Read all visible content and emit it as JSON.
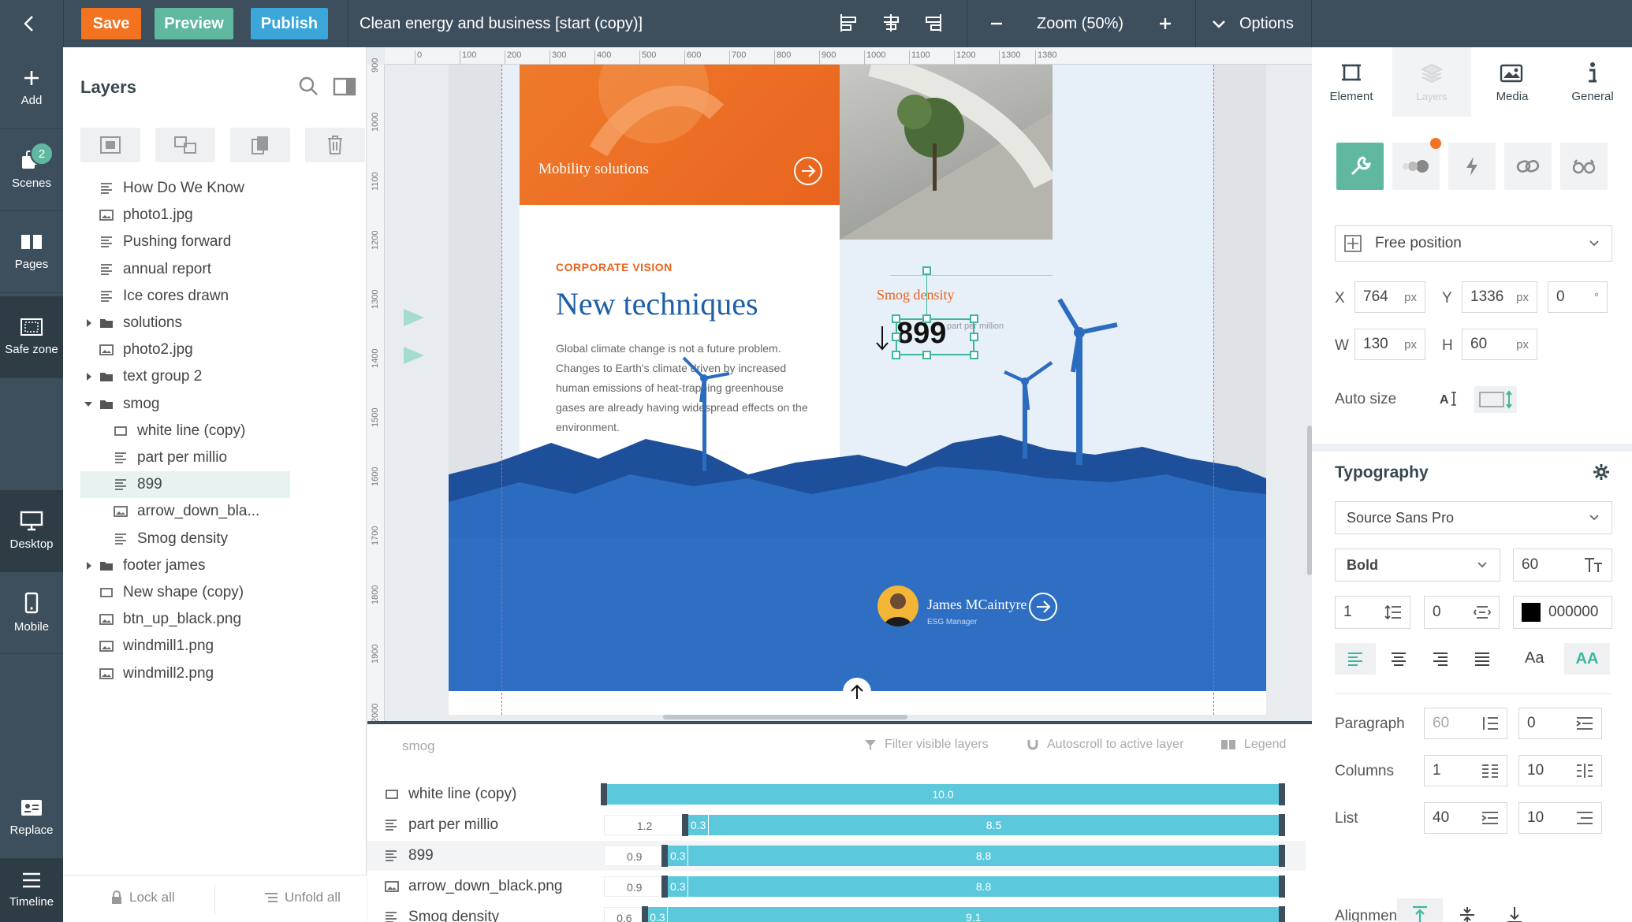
{
  "topbar": {
    "save": "Save",
    "preview": "Preview",
    "publish": "Publish",
    "title": "Clean energy and business [start (copy)]",
    "zoom": "Zoom (50%)",
    "options": "Options"
  },
  "rail": {
    "add": "Add",
    "scenes": "Scenes",
    "scenes_badge": "2",
    "pages": "Pages",
    "safe_zone": "Safe zone",
    "desktop": "Desktop",
    "mobile": "Mobile",
    "replace": "Replace",
    "timeline": "Timeline"
  },
  "layers": {
    "title": "Layers",
    "items": [
      {
        "label": "How Do We Know",
        "type": "text"
      },
      {
        "label": "photo1.jpg",
        "type": "image"
      },
      {
        "label": "Pushing forward",
        "type": "text"
      },
      {
        "label": "annual report",
        "type": "text"
      },
      {
        "label": "Ice cores drawn",
        "type": "text"
      },
      {
        "label": "solutions",
        "type": "folder"
      },
      {
        "label": "photo2.jpg",
        "type": "image"
      },
      {
        "label": "text group 2",
        "type": "folder"
      },
      {
        "label": "smog",
        "type": "folder-open"
      },
      {
        "label": "white line (copy)",
        "type": "shape"
      },
      {
        "label": "part per millio",
        "type": "text"
      },
      {
        "label": "899",
        "type": "text"
      },
      {
        "label": "arrow_down_bla...",
        "type": "image"
      },
      {
        "label": "Smog density",
        "type": "text"
      },
      {
        "label": "footer james",
        "type": "folder"
      },
      {
        "label": "New shape (copy)",
        "type": "shape"
      },
      {
        "label": "btn_up_black.png",
        "type": "image"
      },
      {
        "label": "windmill1.png",
        "type": "image"
      },
      {
        "label": "windmill2.png",
        "type": "image"
      }
    ],
    "lock_all": "Lock all",
    "unfold_all": "Unfold all"
  },
  "ruler": {
    "top": [
      "0",
      "100",
      "200",
      "300",
      "400",
      "500",
      "600",
      "700",
      "800",
      "900",
      "1000",
      "1100",
      "1200",
      "1300",
      "1380"
    ],
    "left": [
      "900",
      "1000",
      "1100",
      "1200",
      "1300",
      "1400",
      "1500",
      "1600",
      "1700",
      "1800",
      "1900",
      "2000"
    ]
  },
  "page": {
    "mobility": "Mobility solutions",
    "corporate_vision": "CORPORATE VISION",
    "headline": "New techniques",
    "body": "Global climate change is not a future problem. Changes to Earth's climate driven by increased human emissions of heat-trapping greenhouse gases are already having widespread effects on the environment.",
    "smog_density": "Smog density",
    "value": "899",
    "unit": "part per million",
    "person_name": "James MCaintyre",
    "person_role": "ESG Manager"
  },
  "rpanel": {
    "tabs": [
      "Element",
      "Layers",
      "Media",
      "General"
    ],
    "position_mode": "Free position",
    "x_label": "X",
    "x": "764",
    "y_label": "Y",
    "y": "1336",
    "rotation": "0",
    "w_label": "W",
    "w": "130",
    "h_label": "H",
    "h": "60",
    "unit": "px",
    "degree": "°",
    "auto_size": "Auto size",
    "typography": "Typography",
    "font": "Source Sans Pro",
    "weight": "Bold",
    "font_size": "60",
    "line_height": "1",
    "letter_spacing": "0",
    "color": "000000",
    "paragraph_label": "Paragraph",
    "paragraph_a": "60",
    "paragraph_b": "0",
    "columns_label": "Columns",
    "columns_a": "1",
    "columns_b": "10",
    "list_label": "List",
    "list_a": "40",
    "list_b": "10",
    "alignment_label": "Alignment",
    "case_label": "Aa",
    "caps_label": "AA"
  },
  "timeline": {
    "group": "smog",
    "filter": "Filter visible layers",
    "autoscroll": "Autoscroll to active layer",
    "legend": "Legend",
    "rows": [
      {
        "label": "white line (copy)",
        "type": "shape",
        "start": "",
        "delay": "",
        "duration": "10.0",
        "start_frac": 0.0,
        "delay_frac": 0.0
      },
      {
        "label": "part per millio",
        "type": "text",
        "start": "1.2",
        "delay": "0.3",
        "duration": "8.5",
        "start_frac": 0.12,
        "delay_frac": 0.03
      },
      {
        "label": "899",
        "type": "text",
        "start": "0.9",
        "delay": "0.3",
        "duration": "8.8",
        "start_frac": 0.09,
        "delay_frac": 0.03
      },
      {
        "label": "arrow_down_black.png",
        "type": "image",
        "start": "0.9",
        "delay": "0.3",
        "duration": "8.8",
        "start_frac": 0.09,
        "delay_frac": 0.03
      },
      {
        "label": "Smog density",
        "type": "text",
        "start": "0.6",
        "delay": "0.3",
        "duration": "9.1",
        "start_frac": 0.06,
        "delay_frac": 0.03
      }
    ]
  }
}
